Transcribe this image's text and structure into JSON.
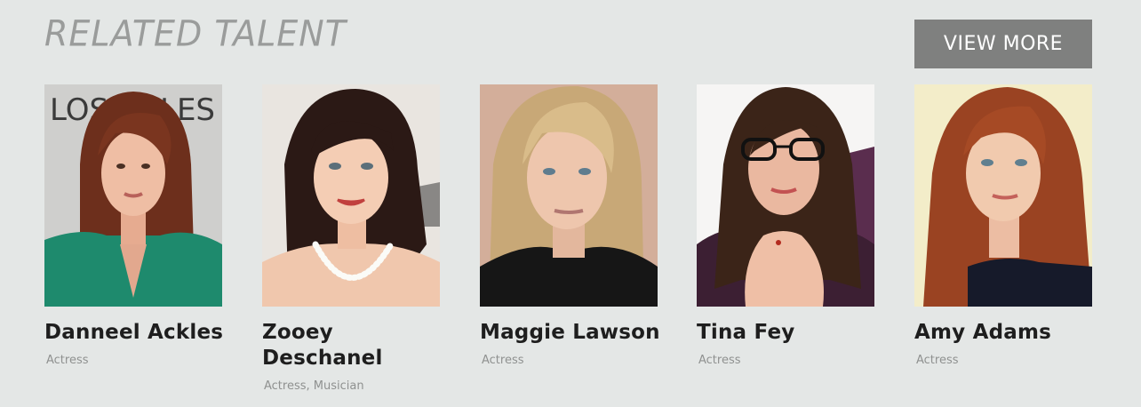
{
  "section": {
    "title": "RELATED TALENT",
    "view_more_label": "VIEW MORE"
  },
  "talent": [
    {
      "name": "Danneel Ackles",
      "role": "Actress",
      "photo_icon": "portrait-photo"
    },
    {
      "name": "Zooey Deschanel",
      "role": "Actress, Musician",
      "photo_icon": "portrait-photo"
    },
    {
      "name": "Maggie Lawson",
      "role": "Actress",
      "photo_icon": "portrait-photo"
    },
    {
      "name": "Tina Fey",
      "role": "Actress",
      "photo_icon": "portrait-photo"
    },
    {
      "name": "Amy Adams",
      "role": "Actress",
      "photo_icon": "portrait-photo"
    }
  ],
  "colors": {
    "background": "#e4e7e6",
    "button": "#7f807f",
    "title": "#9a9c9b",
    "name": "#1e1e1e",
    "role": "#8f9190"
  }
}
